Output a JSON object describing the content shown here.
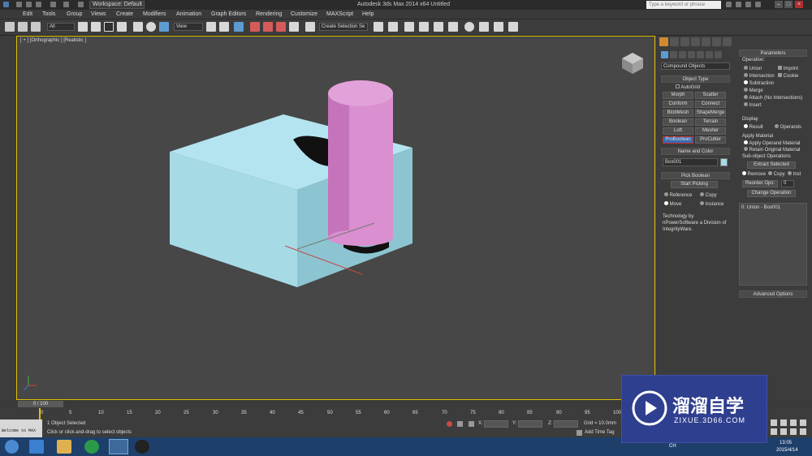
{
  "titlebar": {
    "workspace": "Workspace: Default",
    "app_title": "Autodesk 3ds Max  2014 x64       Untitled",
    "help_search_placeholder": "Type a keyword or phrase"
  },
  "menu": [
    "Edit",
    "Tools",
    "Group",
    "Views",
    "Create",
    "Modifiers",
    "Animation",
    "Graph Editors",
    "Rendering",
    "Customize",
    "MAXScript",
    "Help"
  ],
  "toolbar": {
    "filter": "All",
    "ref_coord": "View",
    "named_selection": "Create Selection Se"
  },
  "viewport": {
    "label": "[ + ] [Orthographic ] [Realistic ]"
  },
  "command_panel": {
    "category": "Compound Objects",
    "object_type": {
      "header": "Object Type",
      "autogrid": "AutoGrid",
      "buttons": [
        "Morph",
        "Scatter",
        "Conform",
        "Connect",
        "BlobMesh",
        "ShapeMerge",
        "Boolean",
        "Terrain",
        "Loft",
        "Mesher",
        "ProBoolean",
        "ProCutter"
      ],
      "active": "ProBoolean"
    },
    "name_color": {
      "header": "Name and Color",
      "name": "Box001",
      "color": "#a6dbe6"
    },
    "pick_boolean": {
      "header": "Pick Boolean",
      "start": "Start Picking",
      "options": [
        "Reference",
        "Copy",
        "Move",
        "Instance"
      ],
      "selected": "Move"
    },
    "credit": "Technology by nPowerSoftware a Division of IntegrityWare."
  },
  "parameters": {
    "header": "Parameters",
    "operation_label": "Operation:",
    "operations": [
      "Union",
      "Imprint",
      "Intersection",
      "Cookie",
      "Subtraction",
      "Merge",
      "Attach (No Intersections)",
      "Insert"
    ],
    "selected_operation": "Subtraction",
    "display_label": "Display",
    "display_options": [
      "Result",
      "Operands"
    ],
    "apply_material_label": "Apply Material",
    "material_options": [
      "Apply Operand Material",
      "Retain Original Material"
    ],
    "subobj_label": "Sub-object Operations",
    "extract": "Extract Selected",
    "extract_options": [
      "Remove",
      "Copy",
      "Inst"
    ],
    "reorder": "Reorder Ops:",
    "reorder_value": "0",
    "change_op": "Change Operation",
    "list_item": "0: Union - Box001",
    "advanced": "Advanced Options"
  },
  "timeline": {
    "frame": "0 / 100",
    "ticks": [
      "0",
      "5",
      "10",
      "15",
      "20",
      "25",
      "30",
      "35",
      "40",
      "45",
      "50",
      "55",
      "60",
      "65",
      "70",
      "75",
      "80",
      "85",
      "90",
      "95",
      "100"
    ]
  },
  "status": {
    "selection": "1 Object Selected",
    "prompt": "Click or click-and-drag to select objects",
    "x_label": "X:",
    "y_label": "Y:",
    "z_label": "Z:",
    "grid": "Grid = 10.0mm",
    "add_time_tag": "Add Time Tag",
    "welcome": "Welcome to MAX"
  },
  "tray": {
    "time": "13:05",
    "date": "2015/4/14",
    "lang": "CH"
  },
  "watermark": {
    "brand": "溜溜自学",
    "url": "ZIXUE.3D66.COM"
  }
}
